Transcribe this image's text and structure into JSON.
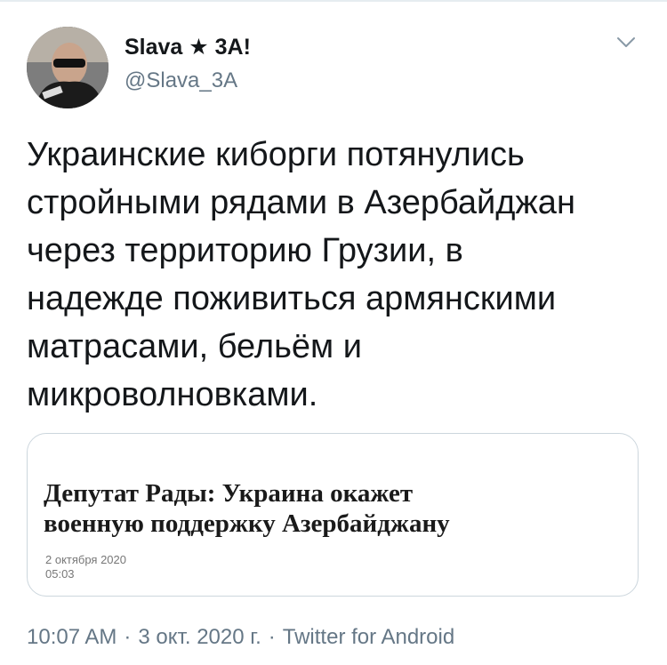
{
  "author": {
    "display_name": "Slava ★ 3A!",
    "handle": "@Slava_3A"
  },
  "tweet": {
    "text": "Украинские киборги потянулись\nстройными рядами в Азербайджан\nчерез территорию Грузии, в\nнадежде поживиться армянскими\nматрасами, бельём и\nмикроволновками."
  },
  "card": {
    "headline": "Депутат Рады: Украина окажет\nвоенную поддержку Азербайджану",
    "date": "2 октября 2020",
    "time": "05:03"
  },
  "meta": {
    "time": "10:07 AM",
    "separator": "·",
    "date": "3 окт. 2020 г.",
    "source": "Twitter for Android"
  },
  "icons": {
    "menu": "chevron-down-icon",
    "avatar": "user-avatar-photo"
  },
  "colors": {
    "text": "#14171a",
    "secondary": "#657786",
    "border": "#ccd6dd"
  }
}
